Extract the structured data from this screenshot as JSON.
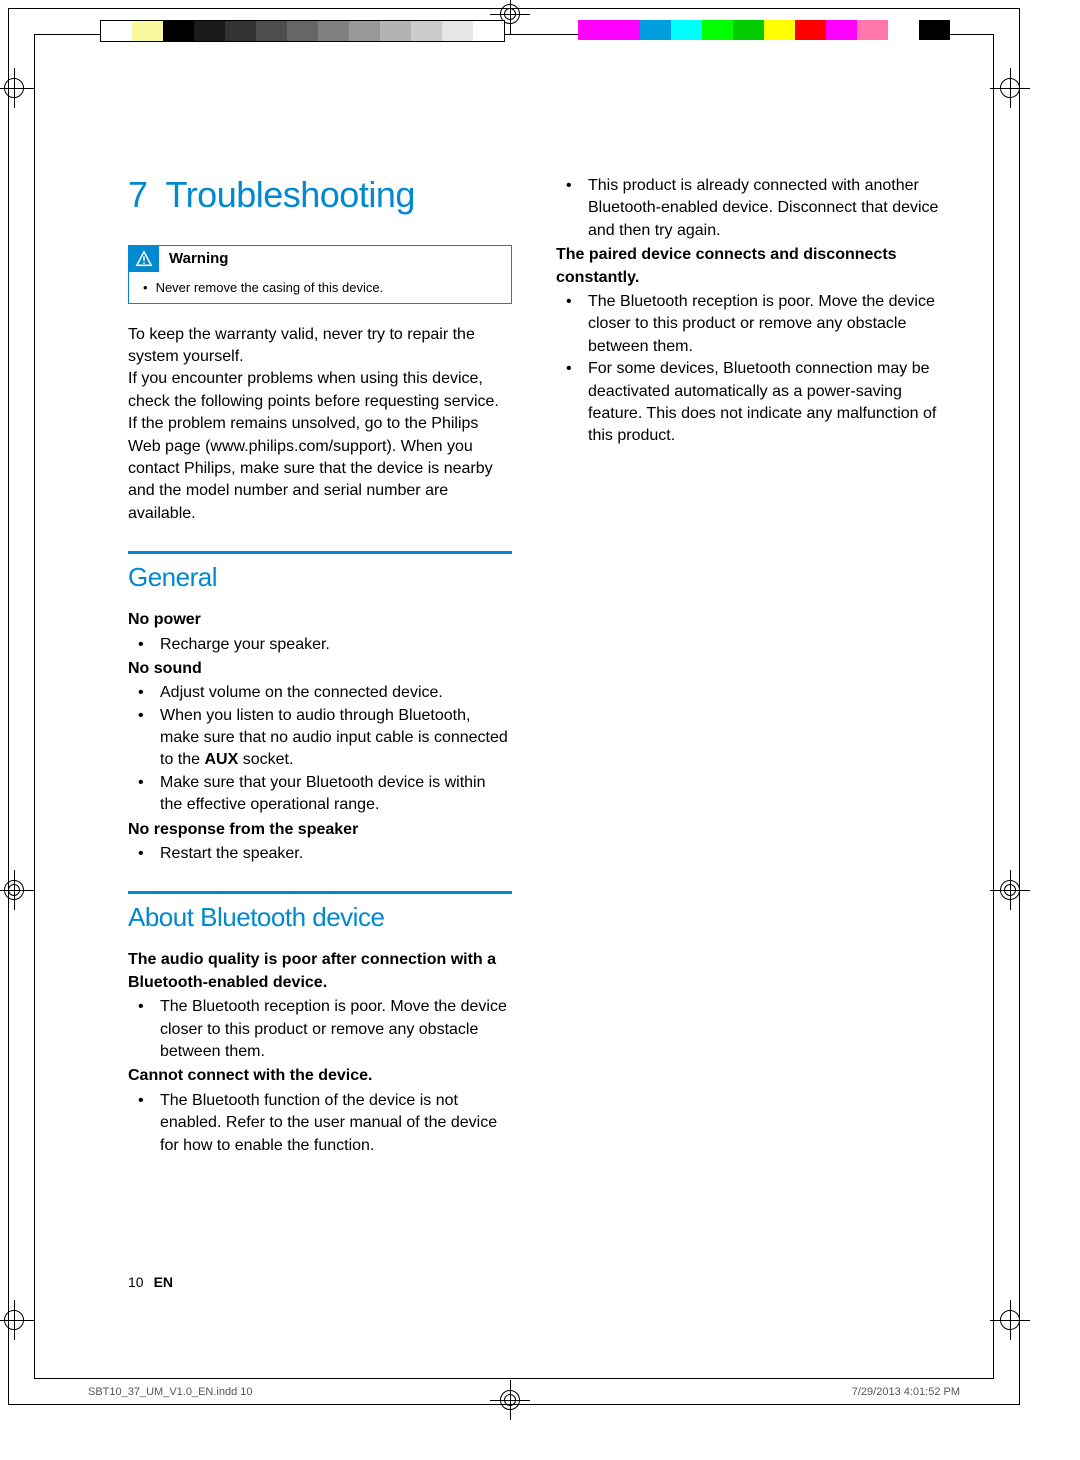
{
  "title_num": "7",
  "title": "Troubleshooting",
  "warn_label": "Warning",
  "warn_text": "Never remove the casing of this device.",
  "intro": "To keep the warranty valid, never try to repair the system yourself.\nIf you encounter problems when using this device, check the following points before requesting service. If the problem remains unsolved, go to the Philips Web page (www.philips.com/support). When you contact Philips, make sure that the device is nearby and the model number and serial number are available.",
  "h_general": "General",
  "g1": "No power",
  "g1_1": "Recharge your speaker.",
  "g2": "No sound",
  "g2_1": "Adjust volume on the connected device.",
  "g2_2": "When you listen to audio through Bluetooth, make sure that no audio input cable is connected to the AUX socket.",
  "g2_3": "Make sure that your Bluetooth device is within the effective operational range.",
  "g3": "No response from the speaker",
  "g3_1": "Restart the speaker.",
  "h_bt": "About Bluetooth device",
  "b1": "The audio quality is poor after connection with a Bluetooth-enabled device.",
  "b1_1": "The Bluetooth reception is poor. Move the device closer to this product or remove any obstacle between them.",
  "b2": "Cannot connect with the device.",
  "b2_1": "The Bluetooth function of the device is not enabled. Refer to the user manual of the device for how to enable the function.",
  "r1": "This product is already connected with another Bluetooth-enabled device. Disconnect that device and then try again.",
  "r2": "The paired device connects and disconnects constantly.",
  "r2_1": "The Bluetooth reception is poor. Move the device closer to this product or remove any obstacle between them.",
  "r2_2": "For some devices, Bluetooth connection may be deactivated automatically as a power-saving feature. This does not indicate any malfunction of this product.",
  "aux": "AUX",
  "pg": "10",
  "lang": "EN",
  "slug_l": "SBT10_37_UM_V1.0_EN.indd   10",
  "slug_r": "7/29/2013   4:01:52 PM",
  "gsw": [
    "#fff",
    "#f9f9a0",
    "#000",
    "#1a1a1a",
    "#333",
    "#4d4d4d",
    "#666",
    "#808080",
    "#999",
    "#b3b3b3",
    "#ccc",
    "#e6e6e6",
    "#fff"
  ],
  "csw": [
    "#ff00ff",
    "#f0f",
    "#00a0e0",
    "#0ff",
    "#0f0",
    "#0c0",
    "#ff0",
    "#f00",
    "#f0f",
    "#f7a",
    "#fff",
    "#000"
  ]
}
